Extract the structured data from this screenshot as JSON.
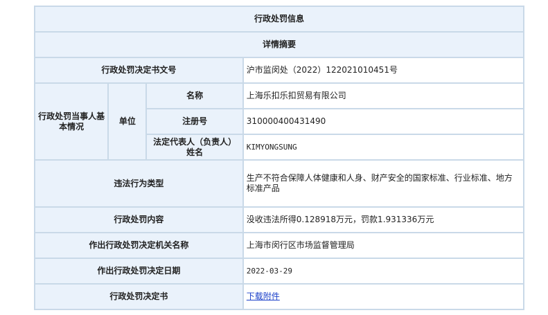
{
  "title": "行政处罚信息",
  "subtitle": "详情摘要",
  "decision_no": {
    "label": "行政处罚决定书文号",
    "value": "沪市监闵处（2022）122021010451号"
  },
  "party": {
    "label": "行政处罚当事人基本情况",
    "type_label": "单位",
    "name": {
      "label": "名称",
      "value": "上海乐扣乐扣贸易有限公司"
    },
    "reg_no": {
      "label": "注册号",
      "value": "310000400431490"
    },
    "legal_rep": {
      "label": "法定代表人（负责人）姓名",
      "value": "KIMYONGSUNG"
    }
  },
  "violation_type": {
    "label": "违法行为类型",
    "value": "生产不符合保障人体健康和人身、财产安全的国家标准、行业标准、地方标准产品"
  },
  "penalty_content": {
    "label": "行政处罚内容",
    "value": "没收违法所得0.128918万元，罚款1.931336万元"
  },
  "authority": {
    "label": "作出行政处罚决定机关名称",
    "value": "上海市闵行区市场监督管理局"
  },
  "decision_date": {
    "label": "作出行政处罚决定日期",
    "value": "2022-03-29"
  },
  "decision_doc": {
    "label": "行政处罚决定书",
    "link_text": "下载附件"
  },
  "colors": {
    "border": "#c9d9e8",
    "label_bg": "#eaf2fb",
    "value_bg": "#ffffff",
    "link": "#1a3fc9"
  }
}
